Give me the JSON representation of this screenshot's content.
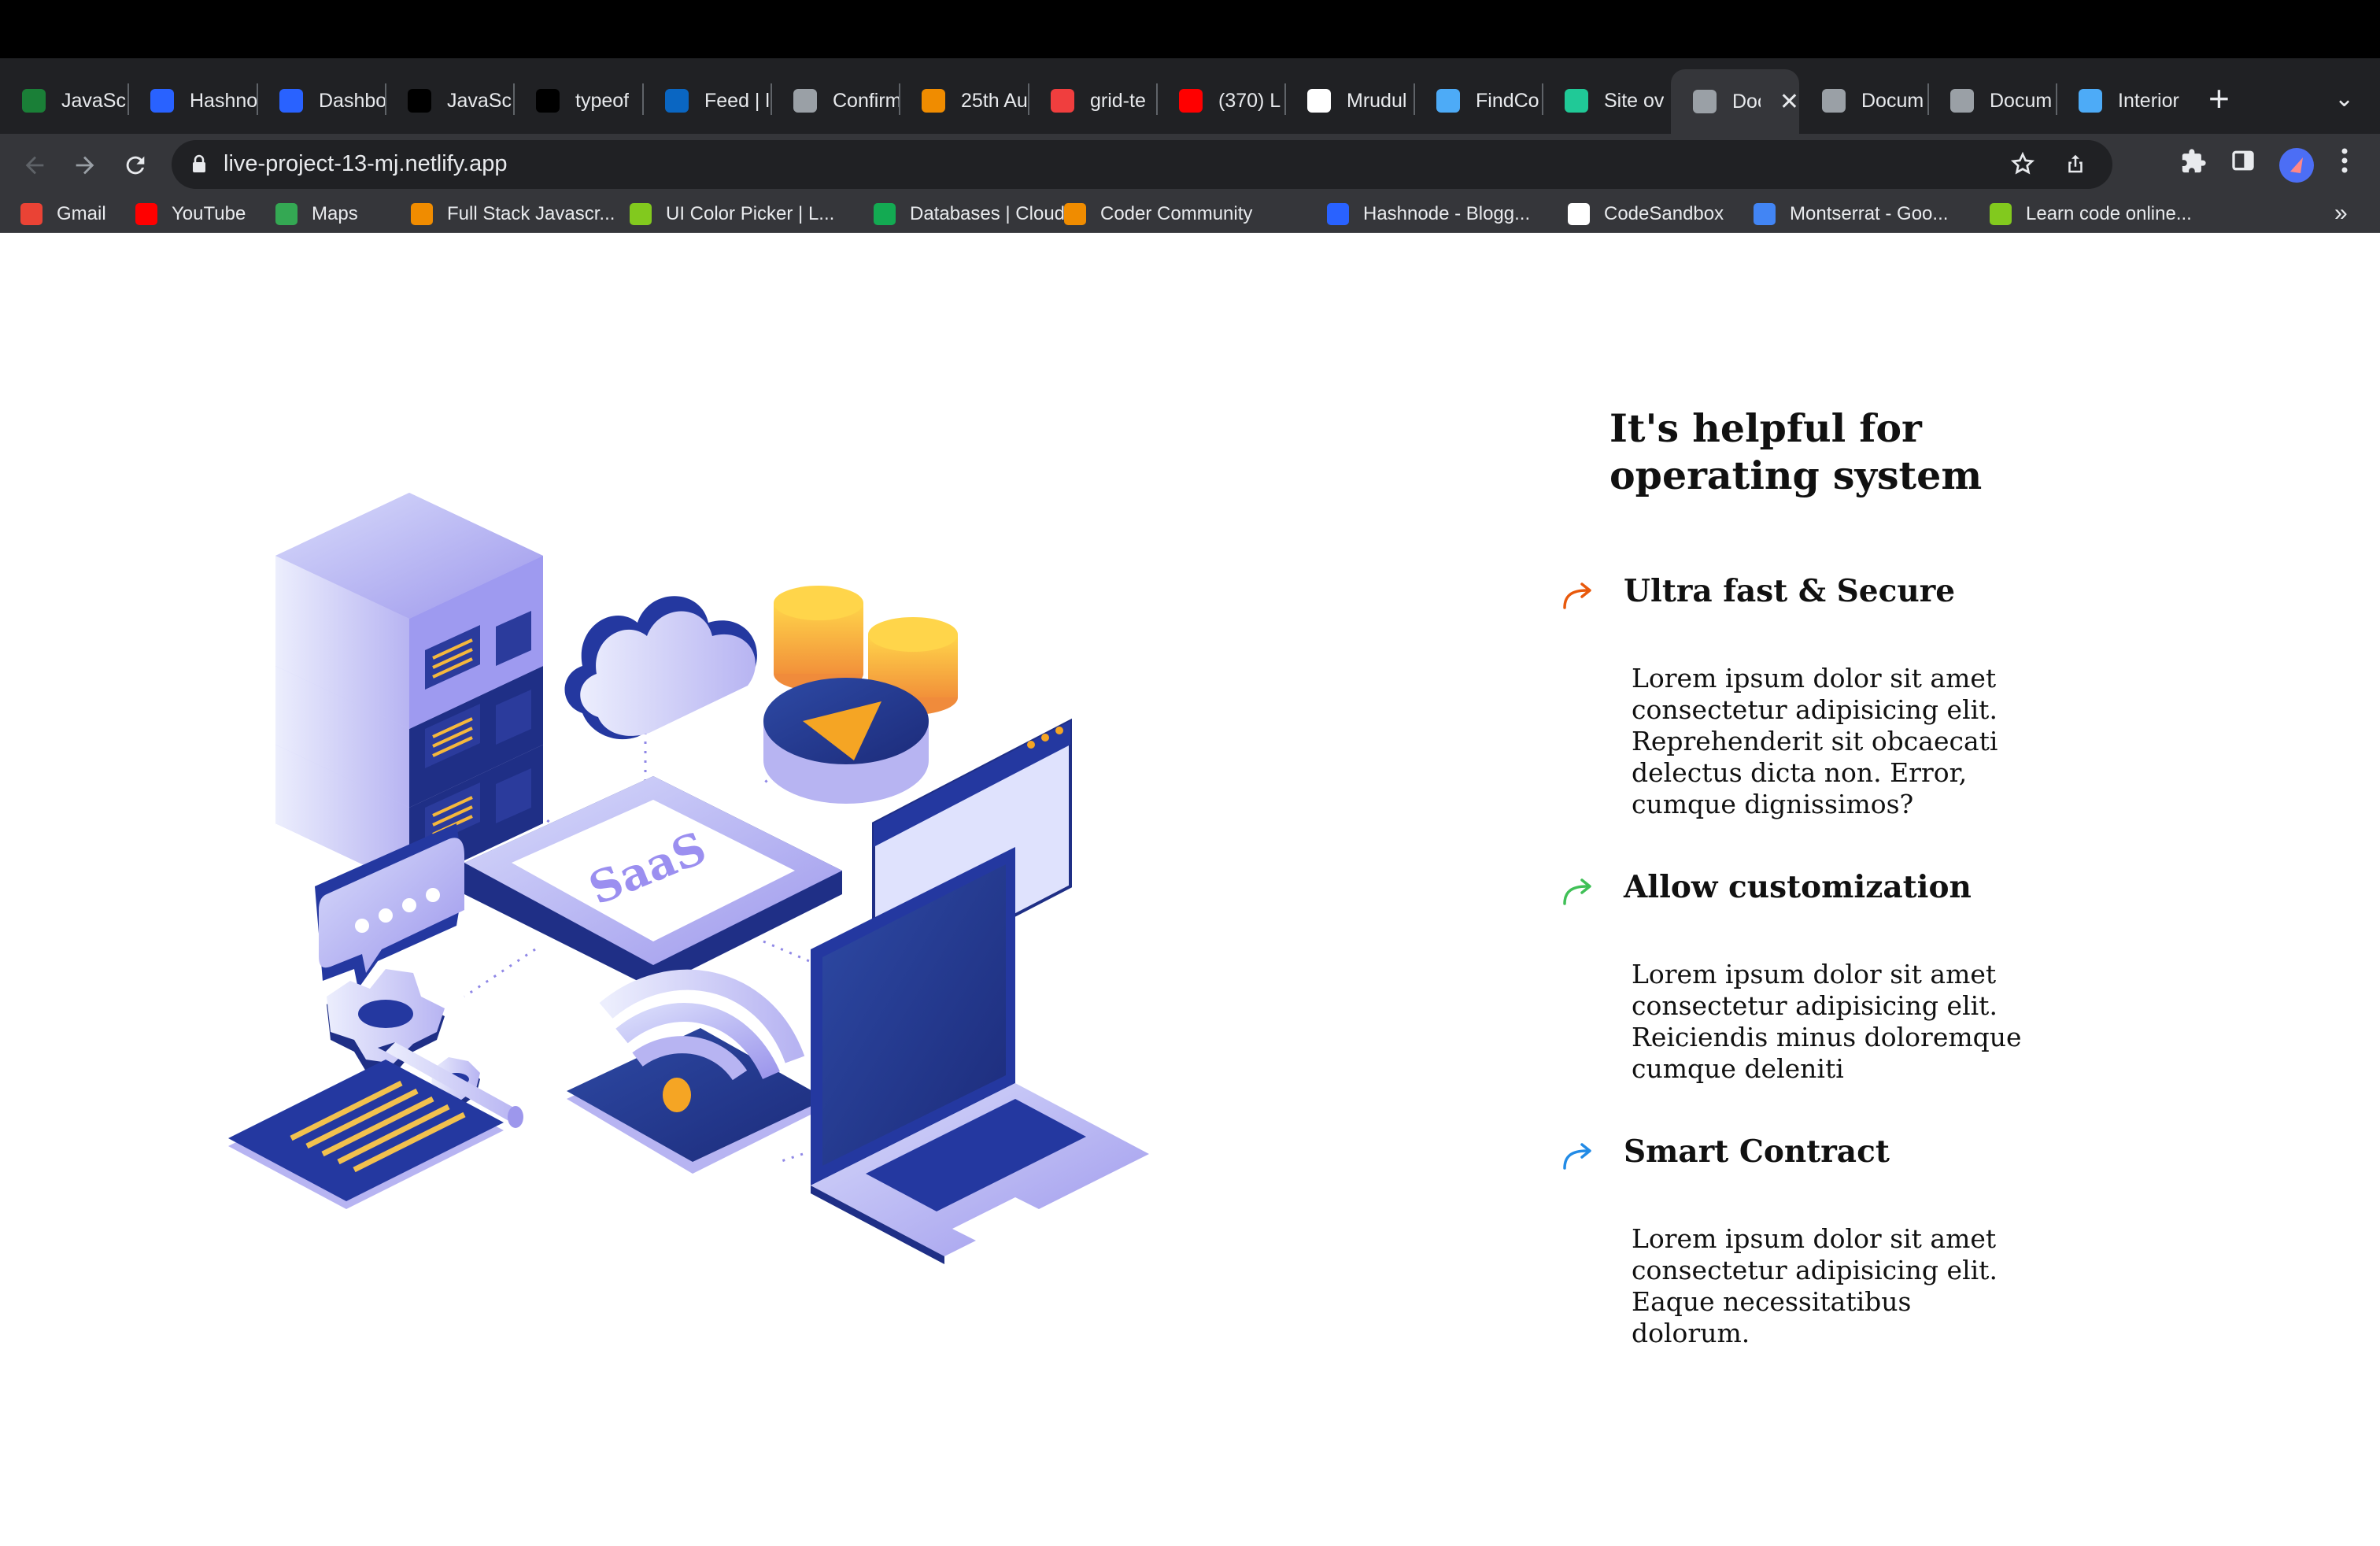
{
  "browser": {
    "tabs": [
      {
        "label": "JavaSc",
        "icon": "w-logo-icon",
        "color": "#1a7f37"
      },
      {
        "label": "Hashno",
        "icon": "hashnode-icon",
        "color": "#2962ff"
      },
      {
        "label": "Dashbo",
        "icon": "hashnode-icon",
        "color": "#2962ff"
      },
      {
        "label": "JavaSc",
        "icon": "medium-icon",
        "color": "#000000"
      },
      {
        "label": "typeof",
        "icon": "medium-icon",
        "color": "#000000"
      },
      {
        "label": "Feed | l",
        "icon": "linkedin-icon",
        "color": "#0a66c2"
      },
      {
        "label": "Confirm",
        "icon": "globe-icon",
        "color": "#9aa0a6"
      },
      {
        "label": "25th Au",
        "icon": "orange-circle-icon",
        "color": "#f08c00"
      },
      {
        "label": "grid-te",
        "icon": "asterisk-icon",
        "color": "#f03e3e"
      },
      {
        "label": "(370) L",
        "icon": "youtube-icon",
        "color": "#ff0000"
      },
      {
        "label": "Mrudul",
        "icon": "github-icon",
        "color": "#ffffff"
      },
      {
        "label": "FindCo",
        "icon": "code-icon",
        "color": "#4dabf7"
      },
      {
        "label": "Site ov",
        "icon": "netlify-icon",
        "color": "#20c997"
      },
      {
        "label": "Doc",
        "icon": "globe-icon",
        "color": "#9aa0a6",
        "active": true
      },
      {
        "label": "Docum",
        "icon": "globe-icon",
        "color": "#9aa0a6"
      },
      {
        "label": "Docum",
        "icon": "globe-icon",
        "color": "#9aa0a6"
      },
      {
        "label": "Interior",
        "icon": "code-icon",
        "color": "#4dabf7"
      }
    ],
    "new_tab": "+",
    "tab_menu": "⌄",
    "url": "live-project-13-mj.netlify.app",
    "bookmarks": [
      {
        "label": "Gmail",
        "icon": "gmail-icon",
        "color": "#ea4335"
      },
      {
        "label": "YouTube",
        "icon": "youtube-icon",
        "color": "#ff0000"
      },
      {
        "label": "Maps",
        "icon": "maps-icon",
        "color": "#34a853"
      },
      {
        "label": "Full Stack Javascr...",
        "icon": "course-icon",
        "color": "#f08c00"
      },
      {
        "label": "UI Color Picker | L...",
        "icon": "color-picker-icon",
        "color": "#82c91e"
      },
      {
        "label": "Databases | Cloud...",
        "icon": "mongodb-leaf-icon",
        "color": "#13aa52"
      },
      {
        "label": "Coder Community",
        "icon": "braces-icon",
        "color": "#f08c00"
      },
      {
        "label": "Hashnode - Blogg...",
        "icon": "hashnode-icon",
        "color": "#2962ff"
      },
      {
        "label": "CodeSandbox",
        "icon": "codesandbox-icon",
        "color": "#ffffff"
      },
      {
        "label": "Montserrat - Goo...",
        "icon": "google-fonts-icon",
        "color": "#4285f4"
      },
      {
        "label": "Learn code online...",
        "icon": "scrimba-icon",
        "color": "#82c91e"
      }
    ],
    "bookmarks_more": "»"
  },
  "page": {
    "title": "It's helpful for operating system",
    "illustration_text": "SaaS",
    "features": [
      {
        "title": "Ultra fast & Secure",
        "body": "Lorem ipsum dolor sit amet consectetur adipisicing elit. Reprehenderit sit obcaecati delectus dicta non. Error, cumque dignissimos?",
        "icon_color": "#e8590c"
      },
      {
        "title": "Allow customization",
        "body": "Lorem ipsum dolor sit amet consectetur adipisicing elit. Reiciendis minus doloremque cumque deleniti",
        "icon_color": "#40c057"
      },
      {
        "title": "Smart Contract",
        "body": "Lorem ipsum dolor sit amet consectetur adipisicing elit. Eaque necessitatibus dolorum.",
        "icon_color": "#228be6"
      }
    ]
  }
}
